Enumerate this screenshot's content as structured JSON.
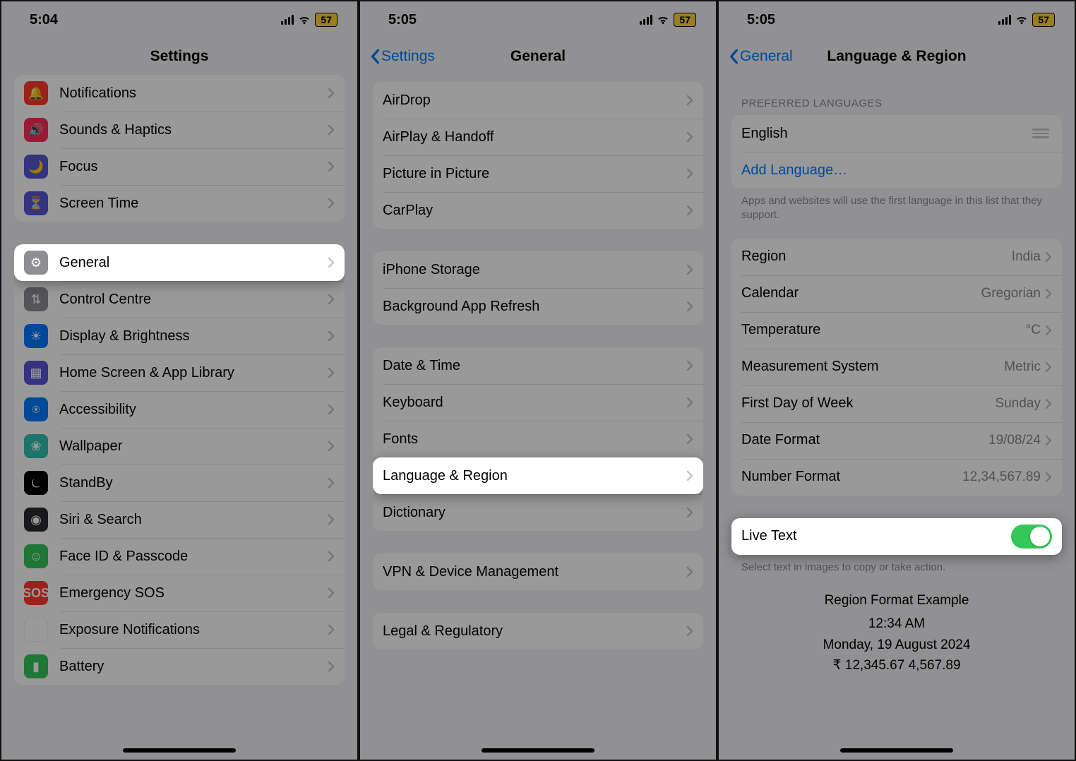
{
  "screens": [
    {
      "status": {
        "time": "5:04",
        "battery": "57"
      },
      "nav": {
        "title": "Settings"
      },
      "group1": [
        {
          "name": "notifications",
          "label": "Notifications",
          "iconClass": "ic-bell",
          "glyph": "🔔"
        },
        {
          "name": "sounds-haptics",
          "label": "Sounds & Haptics",
          "iconClass": "ic-sound",
          "glyph": "🔊"
        },
        {
          "name": "focus",
          "label": "Focus",
          "iconClass": "ic-focus",
          "glyph": "🌙"
        },
        {
          "name": "screen-time",
          "label": "Screen Time",
          "iconClass": "ic-screen",
          "glyph": "⏳"
        }
      ],
      "group2": [
        {
          "name": "general",
          "label": "General",
          "iconClass": "ic-general",
          "glyph": "⚙",
          "highlight": true
        },
        {
          "name": "control-centre",
          "label": "Control Centre",
          "iconClass": "ic-control",
          "glyph": "⇅"
        },
        {
          "name": "display-brightness",
          "label": "Display & Brightness",
          "iconClass": "ic-display",
          "glyph": "☀"
        },
        {
          "name": "home-screen",
          "label": "Home Screen & App Library",
          "iconClass": "ic-home",
          "glyph": "▦"
        },
        {
          "name": "accessibility",
          "label": "Accessibility",
          "iconClass": "ic-access",
          "glyph": "⍟"
        },
        {
          "name": "wallpaper",
          "label": "Wallpaper",
          "iconClass": "ic-wall",
          "glyph": "❀"
        },
        {
          "name": "standby",
          "label": "StandBy",
          "iconClass": "ic-standby",
          "glyph": "⏾"
        },
        {
          "name": "siri-search",
          "label": "Siri & Search",
          "iconClass": "ic-siri",
          "glyph": "◉"
        },
        {
          "name": "face-id",
          "label": "Face ID & Passcode",
          "iconClass": "ic-faceid",
          "glyph": "☺"
        },
        {
          "name": "emergency-sos",
          "label": "Emergency SOS",
          "iconClass": "ic-sos",
          "glyph": "SOS"
        },
        {
          "name": "exposure",
          "label": "Exposure Notifications",
          "iconClass": "ic-exposure",
          "glyph": "✺"
        },
        {
          "name": "battery",
          "label": "Battery",
          "iconClass": "ic-battery",
          "glyph": "▮"
        }
      ]
    },
    {
      "status": {
        "time": "5:05",
        "battery": "57"
      },
      "nav": {
        "back": "Settings",
        "title": "General"
      },
      "group1": [
        {
          "name": "airdrop",
          "label": "AirDrop"
        },
        {
          "name": "airplay",
          "label": "AirPlay & Handoff"
        },
        {
          "name": "pip",
          "label": "Picture in Picture"
        },
        {
          "name": "carplay",
          "label": "CarPlay"
        }
      ],
      "group2": [
        {
          "name": "iphone-storage",
          "label": "iPhone Storage"
        },
        {
          "name": "bg-refresh",
          "label": "Background App Refresh"
        }
      ],
      "group3": [
        {
          "name": "date-time",
          "label": "Date & Time"
        },
        {
          "name": "keyboard",
          "label": "Keyboard"
        },
        {
          "name": "fonts",
          "label": "Fonts"
        },
        {
          "name": "language-region",
          "label": "Language & Region",
          "highlight": true
        },
        {
          "name": "dictionary",
          "label": "Dictionary"
        }
      ],
      "group4": [
        {
          "name": "vpn",
          "label": "VPN & Device Management"
        }
      ],
      "group5": [
        {
          "name": "legal",
          "label": "Legal & Regulatory"
        }
      ]
    },
    {
      "status": {
        "time": "5:05",
        "battery": "57"
      },
      "nav": {
        "back": "General",
        "title": "Language & Region"
      },
      "preferred": {
        "header": "PREFERRED LANGUAGES",
        "lang": "English",
        "add": "Add Language…",
        "footer": "Apps and websites will use the first language in this list that they support."
      },
      "regionRows": [
        {
          "name": "region",
          "label": "Region",
          "value": "India"
        },
        {
          "name": "calendar",
          "label": "Calendar",
          "value": "Gregorian"
        },
        {
          "name": "temperature",
          "label": "Temperature",
          "value": "°C"
        },
        {
          "name": "measurement",
          "label": "Measurement System",
          "value": "Metric"
        },
        {
          "name": "first-day",
          "label": "First Day of Week",
          "value": "Sunday"
        },
        {
          "name": "date-format",
          "label": "Date Format",
          "value": "19/08/24"
        },
        {
          "name": "number-format",
          "label": "Number Format",
          "value": "12,34,567.89"
        }
      ],
      "liveText": {
        "label": "Live Text",
        "footer": "Select text in images to copy or take action."
      },
      "example": {
        "header": "Region Format Example",
        "line1": "12:34 AM",
        "line2": "Monday, 19 August 2024",
        "line3": "₹ 12,345.67   4,567.89"
      }
    }
  ]
}
